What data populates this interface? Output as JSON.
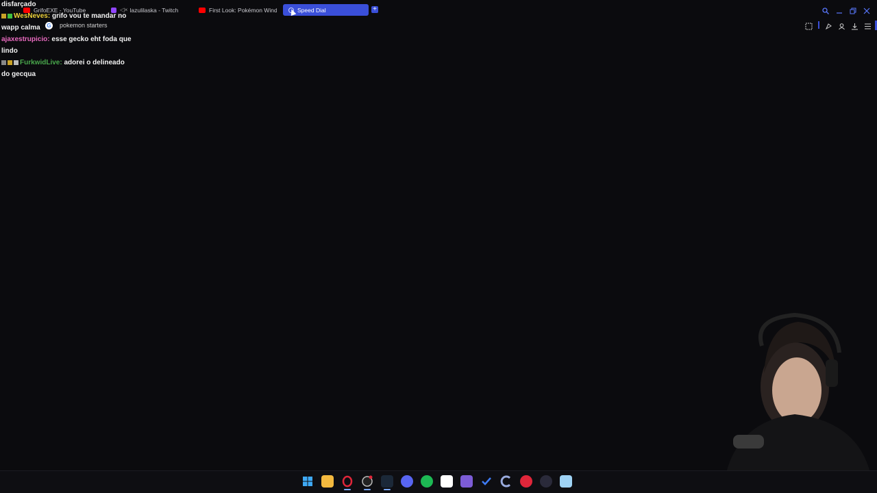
{
  "browser": {
    "tabs": [
      {
        "label": "GrifoEXE - YouTube",
        "icon": "youtube-icon",
        "color": "#ff0000"
      },
      {
        "label": "lazulilaska - Twitch",
        "icon": "twitch-icon",
        "color": "#9146ff"
      },
      {
        "label": "First Look: Pokémon Wind",
        "icon": "youtube-icon",
        "color": "#ff0000"
      },
      {
        "label": "Speed Dial",
        "icon": "speed-dial-icon",
        "color": "#3a4fd9"
      }
    ],
    "new_tab_label": "+",
    "address_suggestion": "pokemon starters",
    "google_glyph": "G",
    "accent": "#3a4fd9"
  },
  "chat": {
    "overlay_line_1": "disfarçado",
    "messages": [
      {
        "user": "WesNeves",
        "text_line1": "grifo vou te mandar no",
        "text_line2": "wapp calma"
      },
      {
        "user": "ajaxestrupicio",
        "text_line1": "esse gecko eht foda que",
        "text_line2": "lindo"
      },
      {
        "user": "FurkwidLive",
        "text_line1": "adorei o delineado",
        "text_line2": "do gecqua"
      }
    ],
    "separator": ":"
  },
  "taskbar": {
    "icons": [
      "windows-start-icon",
      "file-explorer-icon",
      "opera-gx-icon",
      "obs-icon",
      "steam-icon",
      "discord-icon",
      "spotify-icon",
      "notion-icon",
      "obsidian-icon",
      "todo-icon",
      "ccleaner-icon",
      "red-app-icon",
      "arrow-app-icon",
      "notepad-icon"
    ]
  }
}
